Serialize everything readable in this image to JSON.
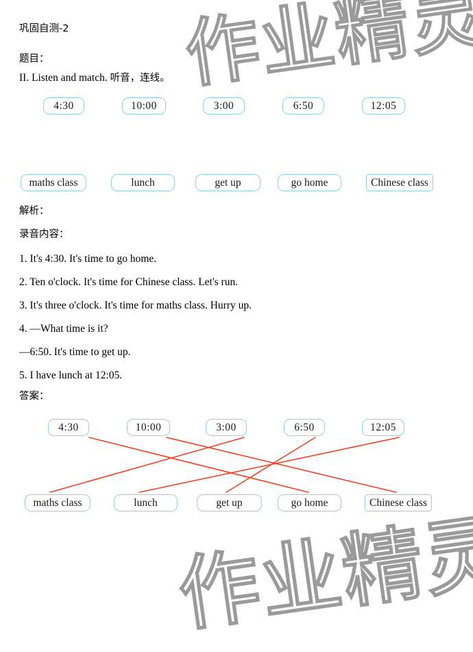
{
  "watermark": {
    "text": "作业精灵"
  },
  "header": {
    "title": "巩固自测-2",
    "question_label": "题目：",
    "instruction_en": "II. Listen and match. ",
    "instruction_cn": "听音，连线。"
  },
  "question": {
    "times": [
      "4:30",
      "10:00",
      "3:00",
      "6:50",
      "12:05"
    ],
    "activities": [
      "maths class",
      "lunch",
      "get up",
      "go home",
      "Chinese class"
    ]
  },
  "analysis": {
    "label": "解析：",
    "script_label": "录音内容：",
    "sentences": [
      "1. It's 4:30. It's time to go home.",
      "2. Ten o'clock. It's time for Chinese class. Let's run.",
      "3. It's three o'clock. It's time for maths class. Hurry up.",
      "4. —What time is it?",
      "—6:50. It's time to get up.",
      "5. I have lunch at 12:05."
    ]
  },
  "answer": {
    "label": "答案：",
    "times": [
      "4:30",
      "10:00",
      "3:00",
      "6:50",
      "12:05"
    ],
    "activities": [
      "maths class",
      "lunch",
      "get up",
      "go home",
      "Chinese class"
    ],
    "line_color": "#ee4422",
    "matches": [
      {
        "time": "4:30",
        "activity": "go home"
      },
      {
        "time": "10:00",
        "activity": "Chinese class"
      },
      {
        "time": "3:00",
        "activity": "maths class"
      },
      {
        "time": "6:50",
        "activity": "get up"
      },
      {
        "time": "12:05",
        "activity": "lunch"
      }
    ]
  },
  "colors": {
    "box_border": "#8fd0ef",
    "line": "#ee4422",
    "watermark": "#9a9a9a",
    "text": "#000000"
  }
}
